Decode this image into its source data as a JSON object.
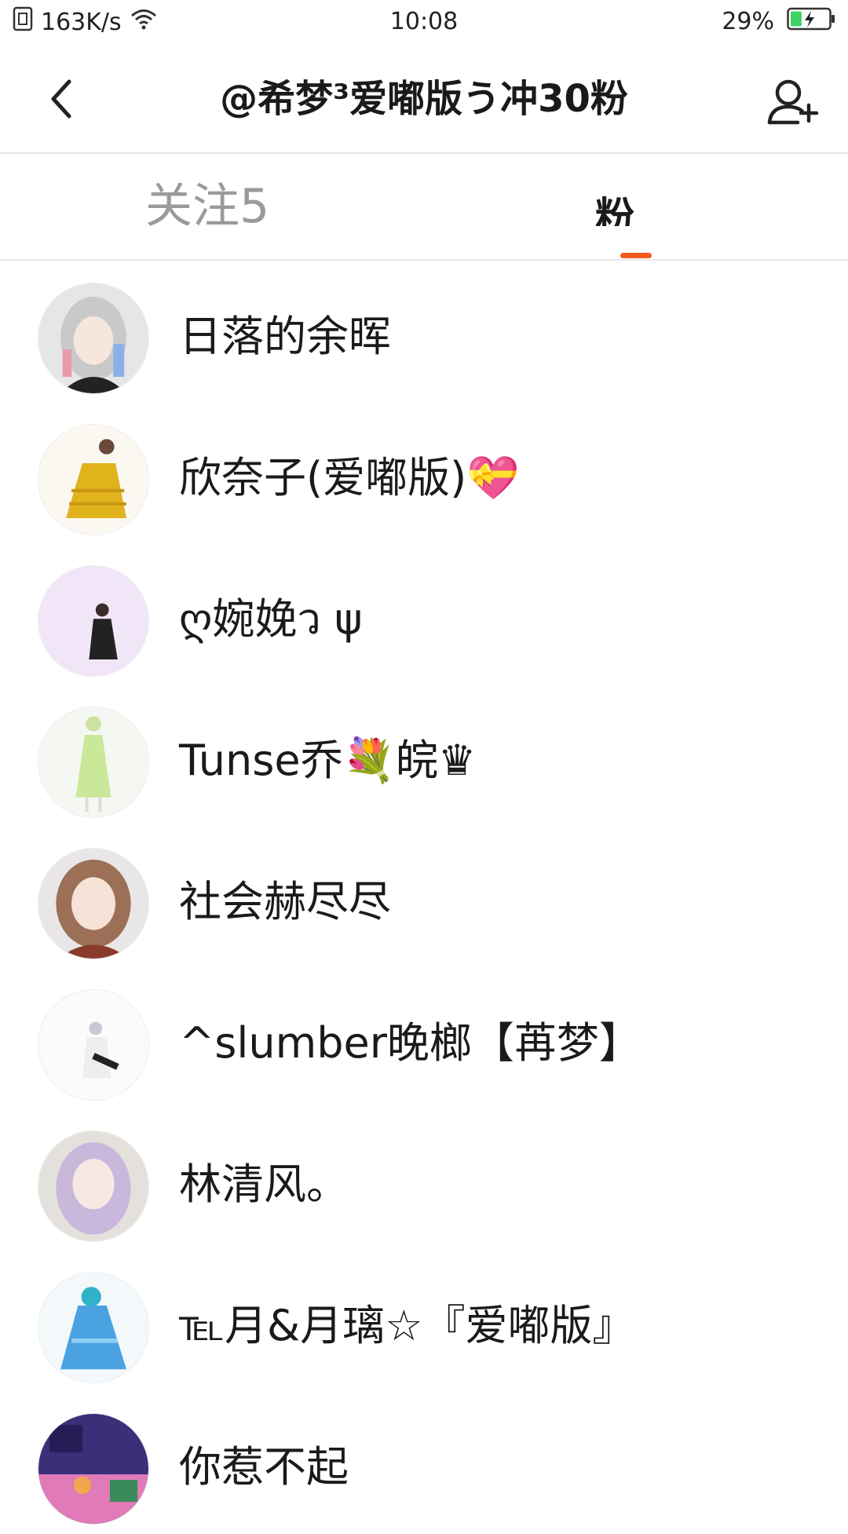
{
  "status_bar": {
    "speed": "163K/s",
    "time": "10:08",
    "battery_pct": "29%",
    "battery_level": 0.29
  },
  "header": {
    "title": "@希梦³爱嘟版う冲30粉"
  },
  "tabs": [
    {
      "label": "关注5",
      "active": false
    },
    {
      "label": "粉",
      "active": true
    }
  ],
  "accent_color": "#f25a1e",
  "fans": [
    {
      "name": "日落的余晖"
    },
    {
      "name": "欣奈子(爱嘟版)💝"
    },
    {
      "name": "ღ婉娩ว ψ"
    },
    {
      "name": "Tunse乔💐皖♛"
    },
    {
      "name": "社会赫尽尽"
    },
    {
      "name": "^slumber晚榔【苒梦】"
    },
    {
      "name": "林清风。"
    },
    {
      "name": "℡月&月璃☆『爱嘟版』"
    },
    {
      "name": "你惹不起"
    }
  ]
}
